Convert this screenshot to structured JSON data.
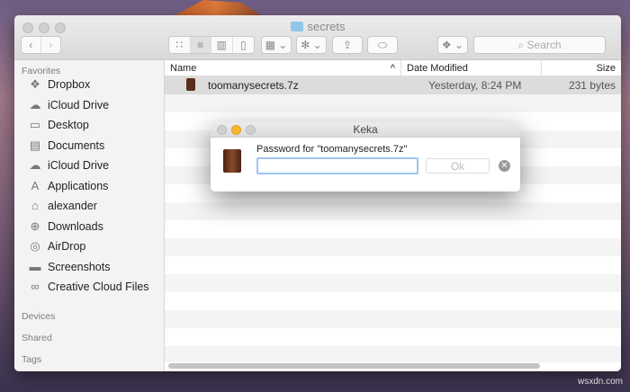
{
  "window": {
    "title": "secrets"
  },
  "toolbar": {
    "search_placeholder": "Search"
  },
  "sidebar": {
    "favorites_label": "Favorites",
    "items": [
      {
        "label": "Dropbox",
        "icon": "dropbox-icon"
      },
      {
        "label": "iCloud Drive",
        "icon": "cloud-icon"
      },
      {
        "label": "Desktop",
        "icon": "desktop-icon"
      },
      {
        "label": "Documents",
        "icon": "documents-icon"
      },
      {
        "label": "iCloud Drive",
        "icon": "cloud-icon"
      },
      {
        "label": "Applications",
        "icon": "applications-icon"
      },
      {
        "label": "alexander",
        "icon": "home-icon"
      },
      {
        "label": "Downloads",
        "icon": "downloads-icon"
      },
      {
        "label": "AirDrop",
        "icon": "airdrop-icon"
      },
      {
        "label": "Screenshots",
        "icon": "folder-icon"
      },
      {
        "label": "Creative Cloud Files",
        "icon": "creative-cloud-icon"
      }
    ],
    "devices_label": "Devices",
    "shared_label": "Shared",
    "tags_label": "Tags"
  },
  "columns": {
    "name": "Name",
    "date": "Date Modified",
    "size": "Size"
  },
  "files": [
    {
      "name": "toomanysecrets.7z",
      "date": "Yesterday, 8:24 PM",
      "size": "231 bytes"
    }
  ],
  "dialog": {
    "title": "Keka",
    "prompt": "Password for \"toomanysecrets.7z\"",
    "password_value": "",
    "ok_label": "Ok"
  },
  "watermark": "wsxdn.com"
}
